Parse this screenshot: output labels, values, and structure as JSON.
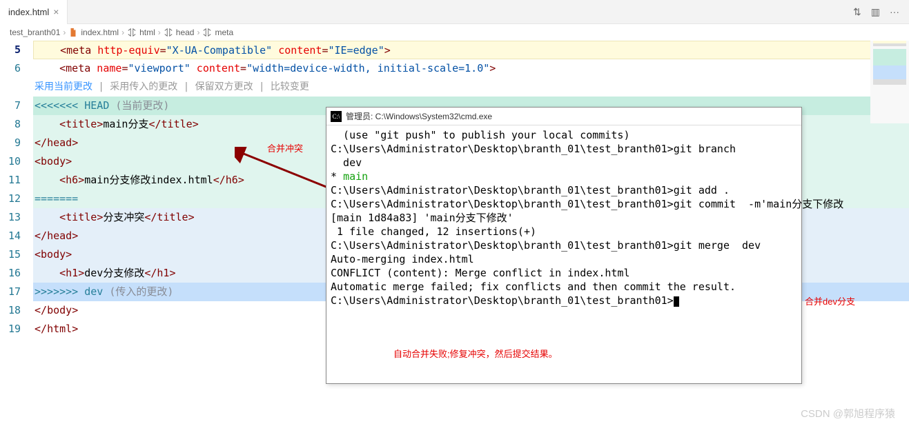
{
  "tab": {
    "name": "index.html",
    "close": "×"
  },
  "actions": {
    "compare": "⇅",
    "split": "▥",
    "more": "···"
  },
  "breadcrumb": {
    "folder": "test_branth01",
    "file": "index.html",
    "p1": "html",
    "p2": "head",
    "p3": "meta",
    "sep": "›"
  },
  "gutter": [
    "5",
    "6",
    "",
    "7",
    "8",
    "9",
    "10",
    "11",
    "12",
    "13",
    "14",
    "15",
    "16",
    "17",
    "18",
    "19"
  ],
  "lens": {
    "accept_current": "采用当前更改",
    "accept_incoming": "采用传入的更改",
    "accept_both": "保留双方更改",
    "compare": "比较变更",
    "sep": " | "
  },
  "code": {
    "l5_a": "    <",
    "l5_tag": "meta",
    "l5_attr1": " http-equiv",
    "l5_eq": "=",
    "l5_str1": "\"X-UA-Compatible\"",
    "l5_attr2": " content",
    "l5_str2": "\"IE=edge\"",
    "l5_c": ">",
    "l6_a": "    <",
    "l6_tag": "meta",
    "l6_attr1": " name",
    "l6_str1": "\"viewport\"",
    "l6_attr2": " content",
    "l6_str2": "\"width=device-width, initial-scale=1.0\"",
    "l6_c": ">",
    "l7_mark": "<<<<<<< HEAD",
    "l7_note": " (当前更改)",
    "l8_a": "    <",
    "l8_tag": "title",
    "l8_txt": "main分支",
    "l8_b": "</",
    "l8_c": ">",
    "l9_a": "</",
    "l9_tag": "head",
    "l9_b": ">",
    "l10_a": "<",
    "l10_tag": "body",
    "l10_b": ">",
    "l11_a": "    <",
    "l11_tag": "h6",
    "l11_txt": "main分支修改index.html",
    "l11_b": "</",
    "l11_c": ">",
    "l12": "=======",
    "l13_a": "    <",
    "l13_tag": "title",
    "l13_txt": "分支冲突",
    "l13_b": "</",
    "l13_c": ">",
    "l14_a": "</",
    "l14_tag": "head",
    "l14_b": ">",
    "l15_a": "<",
    "l15_tag": "body",
    "l15_b": ">",
    "l16_a": "    <",
    "l16_tag": "h1",
    "l16_txt": "dev分支修改",
    "l16_b": "</",
    "l16_c": ">",
    "l17_mark": ">>>>>>> dev",
    "l17_note": " (传入的更改)",
    "l18_a": "</",
    "l18_tag": "body",
    "l18_b": ">",
    "l19_a": "</",
    "l19_tag": "html",
    "l19_b": ">"
  },
  "terminal": {
    "title": "管理员: C:\\Windows\\System32\\cmd.exe",
    "l1": "  (use \"git push\" to publish your local commits)",
    "l2": "",
    "l3": "C:\\Users\\Administrator\\Desktop\\branth_01\\test_branth01>git branch",
    "l4": "  dev",
    "l5": "* ",
    "l5b": "main",
    "l6": "",
    "l7": "C:\\Users\\Administrator\\Desktop\\branth_01\\test_branth01>git add .",
    "l8": "",
    "l9": "C:\\Users\\Administrator\\Desktop\\branth_01\\test_branth01>git commit  -m'main分支下修改",
    "l10": "[main 1d84a83] 'main分支下修改'",
    "l11": " 1 file changed, 12 insertions(+)",
    "l12": "",
    "l13": "C:\\Users\\Administrator\\Desktop\\branth_01\\test_branth01>git merge  dev",
    "l14": "Auto-merging index.html",
    "l15": "CONFLICT (content): Merge conflict in index.html",
    "l16": "Automatic merge failed; fix conflicts and then commit the result.",
    "l17": "",
    "l18": "C:\\Users\\Administrator\\Desktop\\branth_01\\test_branth01>"
  },
  "annotations": {
    "a1": "合并冲突",
    "a2": "合并dev分支",
    "a3": "自动合并失败;修复冲突，然后提交结果。"
  },
  "watermark": "CSDN @郭旭程序猿"
}
